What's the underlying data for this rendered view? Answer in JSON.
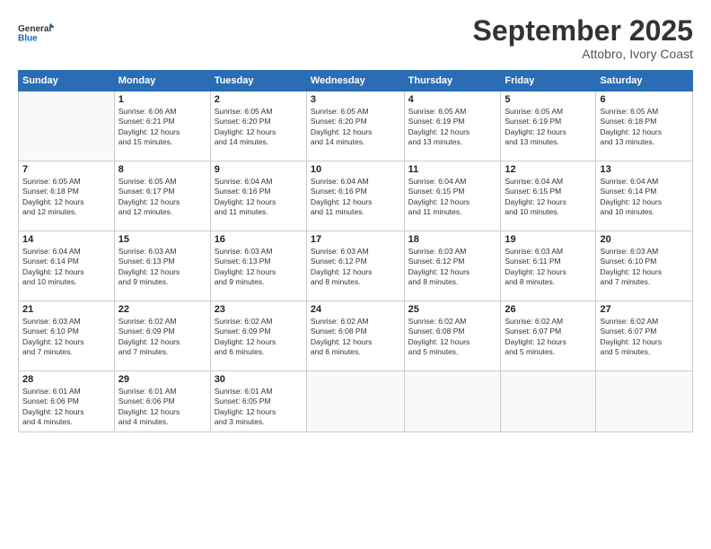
{
  "logo": {
    "line1": "General",
    "line2": "Blue"
  },
  "title": "September 2025",
  "subtitle": "Attobro, Ivory Coast",
  "weekdays": [
    "Sunday",
    "Monday",
    "Tuesday",
    "Wednesday",
    "Thursday",
    "Friday",
    "Saturday"
  ],
  "weeks": [
    [
      {
        "day": "",
        "info": ""
      },
      {
        "day": "1",
        "info": "Sunrise: 6:06 AM\nSunset: 6:21 PM\nDaylight: 12 hours\nand 15 minutes."
      },
      {
        "day": "2",
        "info": "Sunrise: 6:05 AM\nSunset: 6:20 PM\nDaylight: 12 hours\nand 14 minutes."
      },
      {
        "day": "3",
        "info": "Sunrise: 6:05 AM\nSunset: 6:20 PM\nDaylight: 12 hours\nand 14 minutes."
      },
      {
        "day": "4",
        "info": "Sunrise: 6:05 AM\nSunset: 6:19 PM\nDaylight: 12 hours\nand 13 minutes."
      },
      {
        "day": "5",
        "info": "Sunrise: 6:05 AM\nSunset: 6:19 PM\nDaylight: 12 hours\nand 13 minutes."
      },
      {
        "day": "6",
        "info": "Sunrise: 6:05 AM\nSunset: 6:18 PM\nDaylight: 12 hours\nand 13 minutes."
      }
    ],
    [
      {
        "day": "7",
        "info": "Sunrise: 6:05 AM\nSunset: 6:18 PM\nDaylight: 12 hours\nand 12 minutes."
      },
      {
        "day": "8",
        "info": "Sunrise: 6:05 AM\nSunset: 6:17 PM\nDaylight: 12 hours\nand 12 minutes."
      },
      {
        "day": "9",
        "info": "Sunrise: 6:04 AM\nSunset: 6:16 PM\nDaylight: 12 hours\nand 11 minutes."
      },
      {
        "day": "10",
        "info": "Sunrise: 6:04 AM\nSunset: 6:16 PM\nDaylight: 12 hours\nand 11 minutes."
      },
      {
        "day": "11",
        "info": "Sunrise: 6:04 AM\nSunset: 6:15 PM\nDaylight: 12 hours\nand 11 minutes."
      },
      {
        "day": "12",
        "info": "Sunrise: 6:04 AM\nSunset: 6:15 PM\nDaylight: 12 hours\nand 10 minutes."
      },
      {
        "day": "13",
        "info": "Sunrise: 6:04 AM\nSunset: 6:14 PM\nDaylight: 12 hours\nand 10 minutes."
      }
    ],
    [
      {
        "day": "14",
        "info": "Sunrise: 6:04 AM\nSunset: 6:14 PM\nDaylight: 12 hours\nand 10 minutes."
      },
      {
        "day": "15",
        "info": "Sunrise: 6:03 AM\nSunset: 6:13 PM\nDaylight: 12 hours\nand 9 minutes."
      },
      {
        "day": "16",
        "info": "Sunrise: 6:03 AM\nSunset: 6:13 PM\nDaylight: 12 hours\nand 9 minutes."
      },
      {
        "day": "17",
        "info": "Sunrise: 6:03 AM\nSunset: 6:12 PM\nDaylight: 12 hours\nand 8 minutes."
      },
      {
        "day": "18",
        "info": "Sunrise: 6:03 AM\nSunset: 6:12 PM\nDaylight: 12 hours\nand 8 minutes."
      },
      {
        "day": "19",
        "info": "Sunrise: 6:03 AM\nSunset: 6:11 PM\nDaylight: 12 hours\nand 8 minutes."
      },
      {
        "day": "20",
        "info": "Sunrise: 6:03 AM\nSunset: 6:10 PM\nDaylight: 12 hours\nand 7 minutes."
      }
    ],
    [
      {
        "day": "21",
        "info": "Sunrise: 6:03 AM\nSunset: 6:10 PM\nDaylight: 12 hours\nand 7 minutes."
      },
      {
        "day": "22",
        "info": "Sunrise: 6:02 AM\nSunset: 6:09 PM\nDaylight: 12 hours\nand 7 minutes."
      },
      {
        "day": "23",
        "info": "Sunrise: 6:02 AM\nSunset: 6:09 PM\nDaylight: 12 hours\nand 6 minutes."
      },
      {
        "day": "24",
        "info": "Sunrise: 6:02 AM\nSunset: 6:08 PM\nDaylight: 12 hours\nand 6 minutes."
      },
      {
        "day": "25",
        "info": "Sunrise: 6:02 AM\nSunset: 6:08 PM\nDaylight: 12 hours\nand 5 minutes."
      },
      {
        "day": "26",
        "info": "Sunrise: 6:02 AM\nSunset: 6:07 PM\nDaylight: 12 hours\nand 5 minutes."
      },
      {
        "day": "27",
        "info": "Sunrise: 6:02 AM\nSunset: 6:07 PM\nDaylight: 12 hours\nand 5 minutes."
      }
    ],
    [
      {
        "day": "28",
        "info": "Sunrise: 6:01 AM\nSunset: 6:06 PM\nDaylight: 12 hours\nand 4 minutes."
      },
      {
        "day": "29",
        "info": "Sunrise: 6:01 AM\nSunset: 6:06 PM\nDaylight: 12 hours\nand 4 minutes."
      },
      {
        "day": "30",
        "info": "Sunrise: 6:01 AM\nSunset: 6:05 PM\nDaylight: 12 hours\nand 3 minutes."
      },
      {
        "day": "",
        "info": ""
      },
      {
        "day": "",
        "info": ""
      },
      {
        "day": "",
        "info": ""
      },
      {
        "day": "",
        "info": ""
      }
    ]
  ]
}
